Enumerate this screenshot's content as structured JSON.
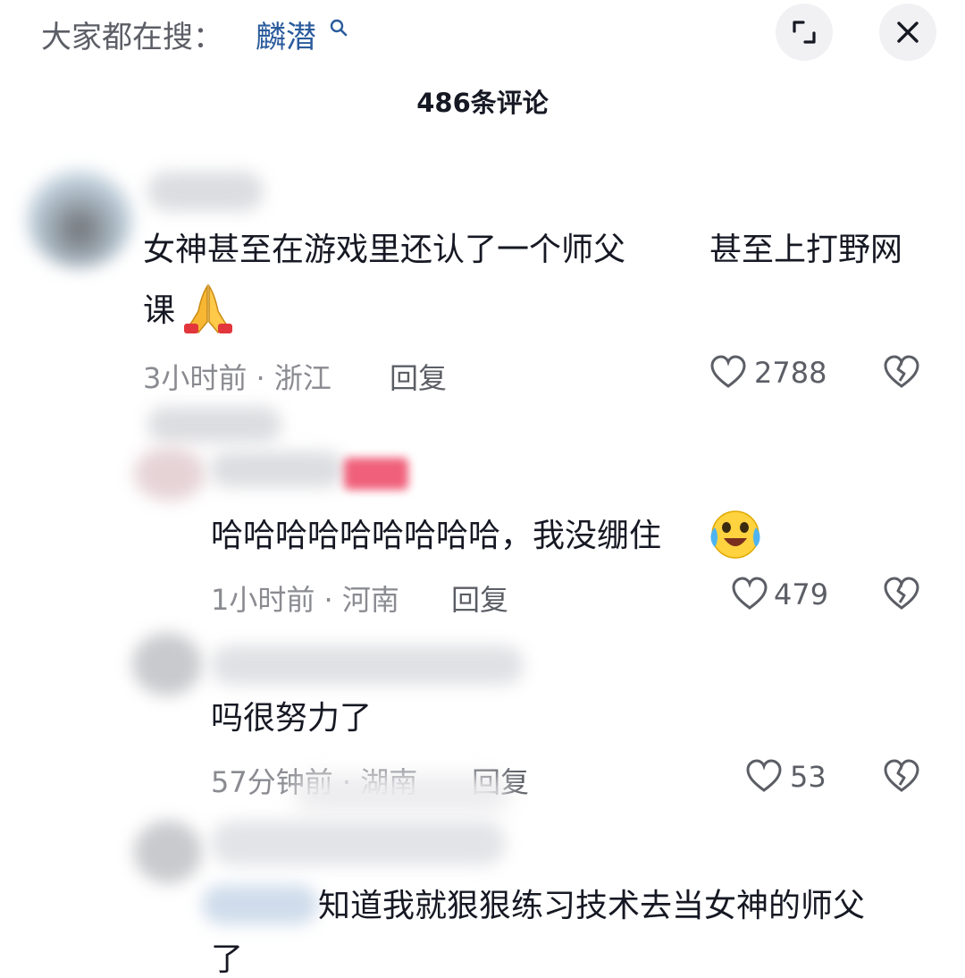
{
  "search": {
    "prefix": "大家都在搜：",
    "term": "麟潜"
  },
  "header": {
    "comment_count": "486条评论"
  },
  "icons": {
    "search": "search-icon",
    "expand": "expand-icon",
    "close": "close-icon",
    "like": "heart-icon",
    "dislike": "broken-heart-icon",
    "emoji_pray": "folded-hands-emoji",
    "emoji_cry_laugh": "crying-laughing-emoji"
  },
  "colors": {
    "search_term": "#2b5b9c",
    "text": "#161823",
    "meta": "#8a8b91",
    "badge": "#fe2c55"
  },
  "comments": [
    {
      "text_line1": "女神甚至在游戏里还认了一个师父",
      "text_line1b": "甚至上打野网",
      "text_line2": "课",
      "time": "3小时前",
      "location": "浙江",
      "reply": "回复",
      "likes": "2788"
    },
    {
      "text_line1": "哈哈哈哈哈哈哈哈哈，我没绷住",
      "time": "1小时前",
      "location": "河南",
      "reply": "回复",
      "likes": "479"
    },
    {
      "text_line1": "吗很努力了",
      "time": "57分钟前",
      "location": "湖南",
      "reply": "回复",
      "likes": "53"
    },
    {
      "text_line1": "知道我就狠狠练习技术去当女神的师父",
      "text_line2": "了"
    }
  ],
  "separator": "·"
}
